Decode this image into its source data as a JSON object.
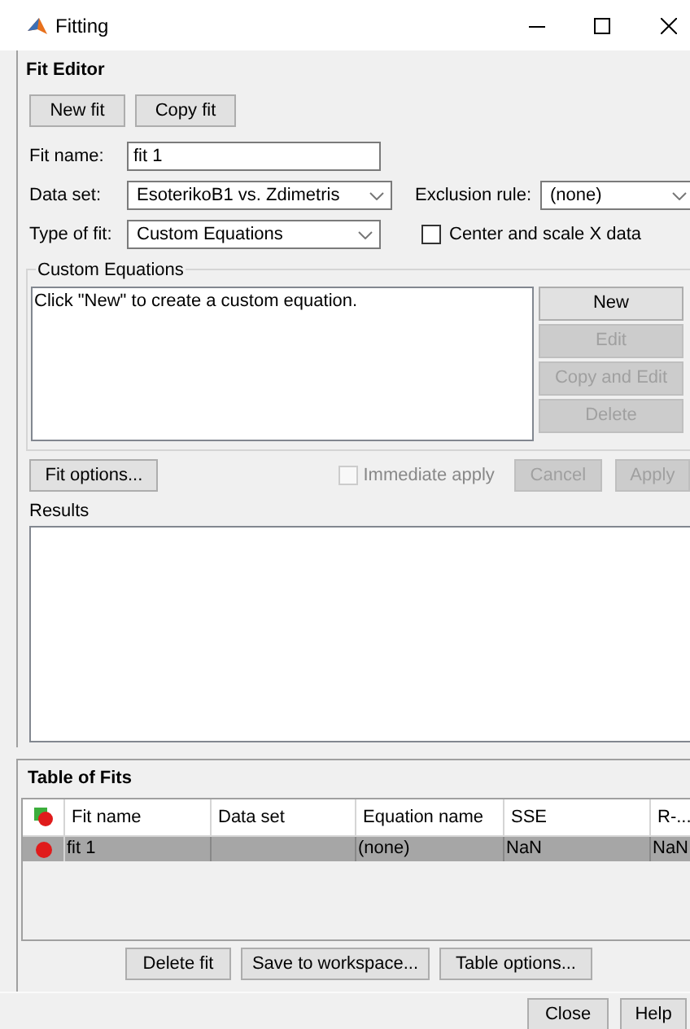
{
  "window": {
    "title": "Fitting"
  },
  "fit_editor": {
    "title": "Fit Editor",
    "buttons": [
      {
        "label": "New fit"
      },
      {
        "label": "Copy fit"
      }
    ],
    "fit_name": {
      "label": "Fit name:",
      "value": "fit 1"
    },
    "data_set": {
      "label": "Data set:",
      "value": "EsoterikoB1 vs. Zdimetris"
    },
    "exclusion_rule": {
      "label": "Exclusion rule:",
      "value": "(none)"
    },
    "type_of_fit": {
      "label": "Type of fit:",
      "value": "Custom Equations"
    },
    "center_scale": {
      "label": "Center and scale X data",
      "checked": false
    },
    "custom_equations": {
      "title": "Custom Equations",
      "list_text": "Click \"New\" to create a custom equation.",
      "buttons": [
        {
          "label": "New",
          "disabled": false
        },
        {
          "label": "Edit",
          "disabled": true
        },
        {
          "label": "Copy and Edit",
          "disabled": true
        },
        {
          "label": "Delete",
          "disabled": true
        }
      ]
    },
    "fit_options": {
      "label": "Fit options..."
    },
    "immediate_apply": {
      "label": "Immediate apply",
      "checked": false,
      "disabled": true
    },
    "action_buttons": [
      {
        "label": "Cancel",
        "disabled": true
      },
      {
        "label": "Apply",
        "disabled": true
      }
    ],
    "results": {
      "label": "Results"
    }
  },
  "table_of_fits": {
    "title": "Table of Fits",
    "columns": [
      "Fit name",
      "Data set",
      "Equation name",
      "SSE",
      "R-..."
    ],
    "rows": [
      {
        "selected": true,
        "cells": [
          "fit 1",
          "",
          "(none)",
          "NaN",
          "NaN"
        ]
      }
    ],
    "buttons": [
      {
        "label": "Delete fit"
      },
      {
        "label": "Save to workspace..."
      },
      {
        "label": "Table options..."
      }
    ]
  },
  "footer_buttons": [
    {
      "label": "Close"
    },
    {
      "label": "Help"
    }
  ]
}
